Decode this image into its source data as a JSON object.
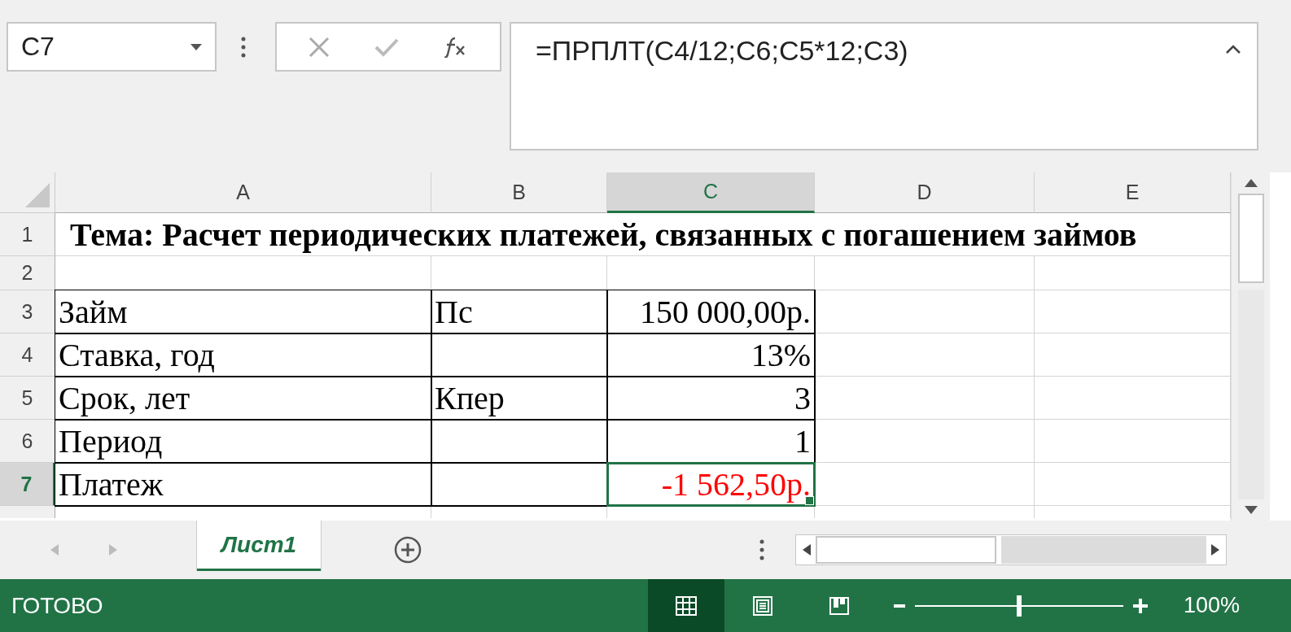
{
  "formula_bar": {
    "name_box": "C7",
    "formula": "=ПРПЛТ(C4/12;C6;C5*12;C3)"
  },
  "columns": [
    {
      "label": "A",
      "selected": false
    },
    {
      "label": "B",
      "selected": false
    },
    {
      "label": "C",
      "selected": true
    },
    {
      "label": "D",
      "selected": false
    },
    {
      "label": "E",
      "selected": false
    }
  ],
  "rows": [
    {
      "label": "1",
      "selected": false,
      "cells": {
        "A": {
          "text": "Тема: Расчет периодических платежей, связанных с погашением займов",
          "kind": "title"
        }
      }
    },
    {
      "label": "2",
      "selected": false,
      "cells": {}
    },
    {
      "label": "3",
      "selected": false,
      "cells": {
        "A": {
          "text": "Займ",
          "border": true
        },
        "B": {
          "text": "Пс",
          "border": true
        },
        "C": {
          "text": "150 000,00р.",
          "kind": "number",
          "border": true
        }
      }
    },
    {
      "label": "4",
      "selected": false,
      "cells": {
        "A": {
          "text": "Ставка, год",
          "border": true
        },
        "B": {
          "border": true
        },
        "C": {
          "text": "13%",
          "kind": "number",
          "border": true
        }
      }
    },
    {
      "label": "5",
      "selected": false,
      "cells": {
        "A": {
          "text": "Срок, лет",
          "border": true
        },
        "B": {
          "text": "Кпер",
          "border": true
        },
        "C": {
          "text": "3",
          "kind": "number",
          "border": true
        }
      }
    },
    {
      "label": "6",
      "selected": false,
      "cells": {
        "A": {
          "text": "Период",
          "border": true
        },
        "B": {
          "border": true
        },
        "C": {
          "text": "1",
          "kind": "number",
          "border": true
        }
      }
    },
    {
      "label": "7",
      "selected": true,
      "cells": {
        "A": {
          "text": "Платеж",
          "border": true
        },
        "B": {
          "border": true
        },
        "C": {
          "text": "-1 562,50р.",
          "kind": "number",
          "border": true,
          "selected": true,
          "color": "#ff0000"
        }
      }
    }
  ],
  "sheet_tabs": [
    {
      "label": "Лист1",
      "selected": true
    }
  ],
  "status_bar": {
    "status": "ГОТОВО",
    "views": [
      {
        "kind": "normal",
        "selected": true
      },
      {
        "kind": "page-layout",
        "selected": false
      },
      {
        "kind": "page-break",
        "selected": false
      }
    ],
    "zoom": {
      "level": 0.5,
      "reading": "100%"
    }
  }
}
